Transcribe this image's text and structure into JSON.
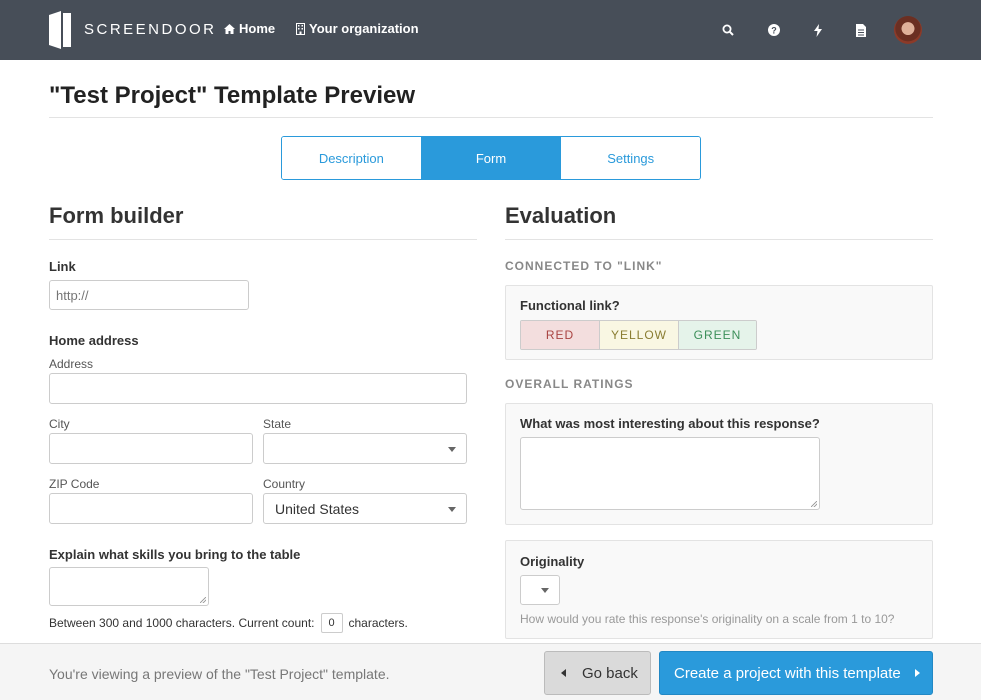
{
  "nav": {
    "brand": "SCREENDOOR",
    "home_label": "Home",
    "org_label": "Your organization",
    "icons": [
      "search-icon",
      "help-icon",
      "bolt-icon",
      "document-icon"
    ]
  },
  "page": {
    "title": "\"Test Project\" Template Preview"
  },
  "tabs": [
    {
      "label": "Description",
      "active": false
    },
    {
      "label": "Form",
      "active": true
    },
    {
      "label": "Settings",
      "active": false
    }
  ],
  "form_builder": {
    "heading": "Form builder",
    "link": {
      "label": "Link",
      "placeholder": "http://"
    },
    "address": {
      "label": "Home address",
      "address_label": "Address",
      "city_label": "City",
      "state_label": "State",
      "state_value": "",
      "zip_label": "ZIP Code",
      "country_label": "Country",
      "country_value": "United States"
    },
    "skills": {
      "label": "Explain what skills you bring to the table",
      "count_prefix": "Between 300 and 1000 characters. Current count:",
      "count_value": "0",
      "count_suffix": "characters."
    }
  },
  "evaluation": {
    "heading": "Evaluation",
    "connected_label": "CONNECTED TO \"LINK\"",
    "functional_label": "Functional link?",
    "ratings": [
      "RED",
      "YELLOW",
      "GREEN"
    ],
    "overall_label": "OVERALL RATINGS",
    "interesting_label": "What was most interesting about this response?",
    "originality_label": "Originality",
    "originality_help": "How would you rate this response's originality on a scale from 1 to 10?"
  },
  "footer": {
    "text": "You're viewing a preview of the \"Test Project\" template.",
    "back_label": "Go back",
    "create_label": "Create a project with this template"
  },
  "colors": {
    "nav_bg": "#474e58",
    "accent": "#2a9adb"
  }
}
